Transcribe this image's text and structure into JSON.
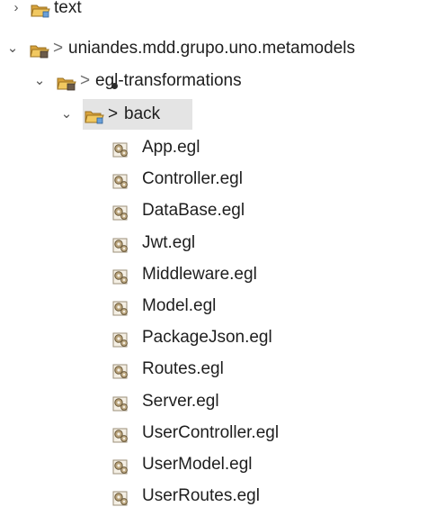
{
  "tree": {
    "text_folder": "text",
    "project": {
      "decorator": ">",
      "name": "uniandes.mdd.grupo.uno.metamodels"
    },
    "egl_folder": {
      "decorator": ">",
      "name": "egl-transformations"
    },
    "back_folder": {
      "decorator": ">",
      "name": "back"
    },
    "files": [
      "App.egl",
      "Controller.egl",
      "DataBase.egl",
      "Jwt.egl",
      "Middleware.egl",
      "Model.egl",
      "PackageJson.egl",
      "Routes.egl",
      "Server.egl",
      "UserController.egl",
      "UserModel.egl",
      "UserRoutes.egl"
    ]
  },
  "icons": {
    "collapsed": "chevron-right-icon",
    "expanded": "chevron-down-icon",
    "folder": "folder-icon",
    "project": "project-folder-icon",
    "package": "package-folder-icon",
    "file": "egl-template-file-icon"
  },
  "colors": {
    "selection": "#e4e4e4",
    "folder": "#e8b84a",
    "text": "#1e1e1e",
    "decorator": "#6e6e6e"
  }
}
